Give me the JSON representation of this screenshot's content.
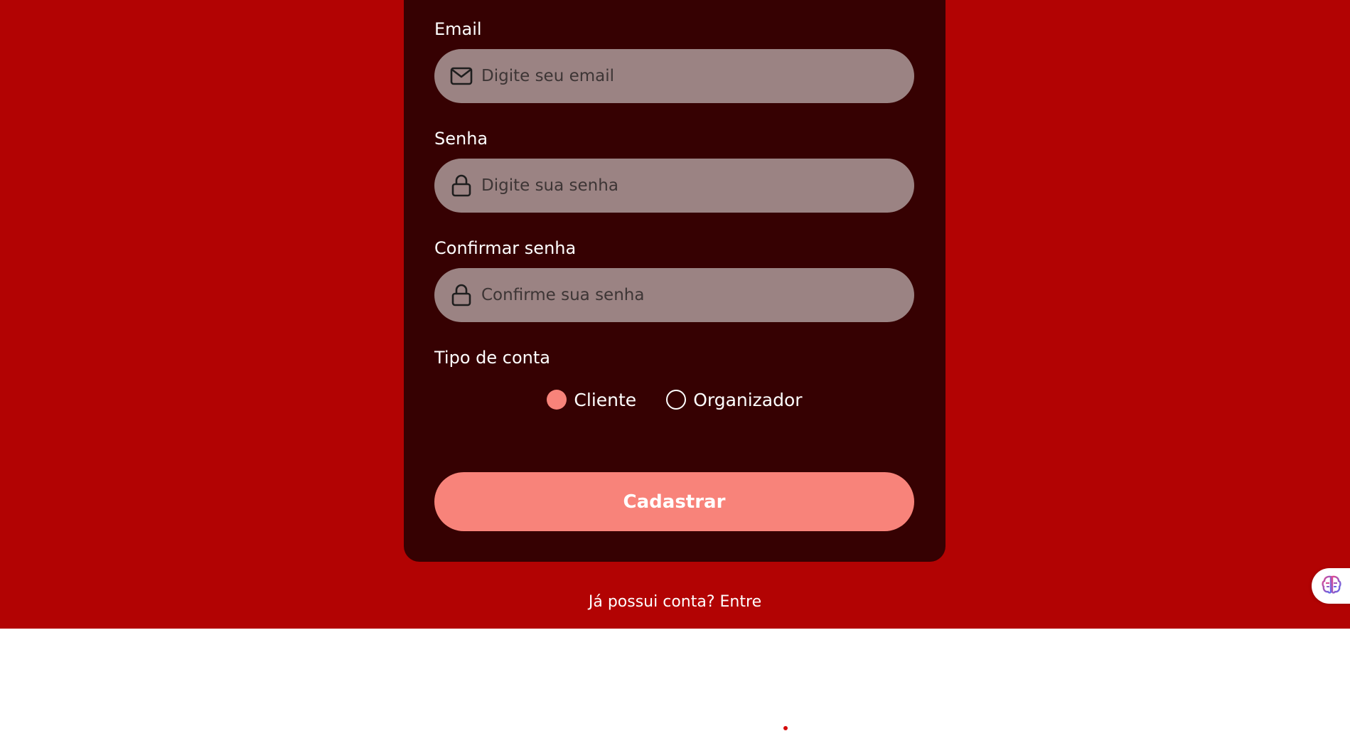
{
  "form": {
    "email": {
      "label": "Email",
      "placeholder": "Digite seu email",
      "value": "",
      "icon": "mail-icon"
    },
    "password": {
      "label": "Senha",
      "placeholder": "Digite sua senha",
      "value": "",
      "icon": "lock-icon"
    },
    "confirm_password": {
      "label": "Confirmar senha",
      "placeholder": "Confirme sua senha",
      "value": "",
      "icon": "lock-icon"
    },
    "account_type": {
      "label": "Tipo de conta",
      "options": [
        {
          "label": "Cliente",
          "selected": true
        },
        {
          "label": "Organizador",
          "selected": false
        }
      ]
    },
    "submit_label": "Cadastrar"
  },
  "footer": {
    "prompt": "Já possui conta?",
    "link_label": "Entre"
  },
  "colors": {
    "page_background": "#b20303",
    "card_background": "#360102",
    "input_background": "#9b8383",
    "accent": "#f8837a"
  }
}
